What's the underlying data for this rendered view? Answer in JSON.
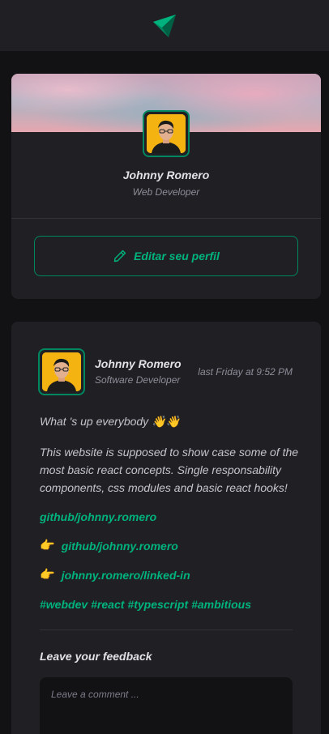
{
  "header": {
    "logo_icon": "paper-plane-logo-icon",
    "accent": "#00b37e"
  },
  "profile": {
    "name": "Johnny Romero",
    "role": "Web Developer",
    "edit_label": "Editar seu perfil",
    "edit_icon": "pencil-icon"
  },
  "post": {
    "author_name": "Johnny Romero",
    "author_role": "Software Developer",
    "time": "last Friday at 9:52 PM",
    "greeting": "What 's up everybody 👋👋",
    "paragraph": "This website is supposed to show case some of the most basic react concepts. Single responsability components, css modules and basic react hooks!",
    "link1": "github/johnny.romero",
    "link2_emoji": "👉",
    "link2": "github/johnny.romero",
    "link3_emoji": "👉",
    "link3": "johnny.romero/linked-in",
    "hashtags": [
      "#webdev",
      "#react",
      "#typescript",
      "#ambitious"
    ]
  },
  "feedback": {
    "title": "Leave your feedback",
    "placeholder": "Leave a comment ..."
  }
}
